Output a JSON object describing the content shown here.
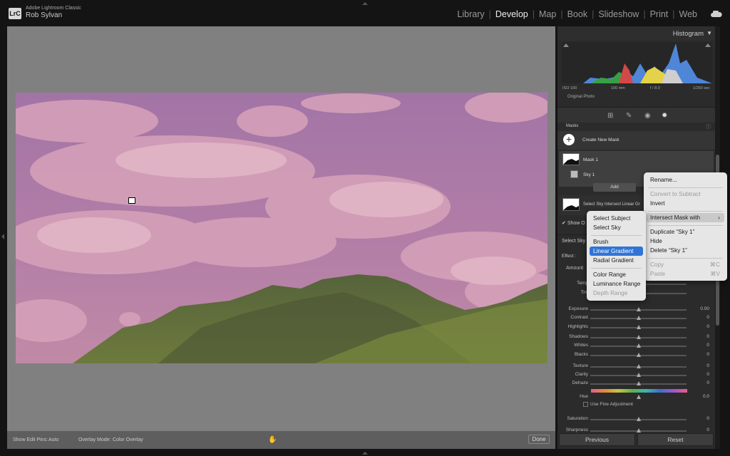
{
  "app": {
    "logo": "LrC",
    "product": "Adobe Lightroom Classic",
    "user": "Rob Sylvan"
  },
  "modules": [
    "Library",
    "Develop",
    "Map",
    "Book",
    "Slideshow",
    "Print",
    "Web"
  ],
  "active_module": "Develop",
  "bottom_bar": {
    "show_edit_pins_label": "Show Edit Pins:",
    "show_edit_pins_value": "Auto",
    "overlay_mode_label": "Overlay Mode:",
    "overlay_mode_value": "Color Overlay",
    "done": "Done"
  },
  "histogram": {
    "title": "Histogram",
    "iso": "ISO 100",
    "focal": "100 mm",
    "aperture": "f / 8.0",
    "shutter": "1/250 sec",
    "original_photo": "Original Photo"
  },
  "masks": {
    "header": "Masks",
    "create_new": "Create New Mask",
    "mask1": "Mask 1",
    "sky1": "Sky 1",
    "add": "Add",
    "select_row": "Select Sky Intersect Linear Gr",
    "show_overlay": "Show O",
    "select_sky": "Select Sky",
    "effect": "Effect :",
    "amount": "Amount"
  },
  "sliders": [
    {
      "label": "Temp",
      "value": "",
      "pos": 0.5
    },
    {
      "label": "Tint",
      "value": "",
      "pos": 0.5
    },
    {
      "label": "Exposure",
      "value": "0.00",
      "pos": 0.5
    },
    {
      "label": "Contrast",
      "value": "0",
      "pos": 0.5
    },
    {
      "label": "Highlights",
      "value": "0",
      "pos": 0.5
    },
    {
      "label": "Shadows",
      "value": "0",
      "pos": 0.5
    },
    {
      "label": "Whites",
      "value": "0",
      "pos": 0.5
    },
    {
      "label": "Blacks",
      "value": "0",
      "pos": 0.5
    },
    {
      "label": "Texture",
      "value": "0",
      "pos": 0.5
    },
    {
      "label": "Clarity",
      "value": "0",
      "pos": 0.5
    },
    {
      "label": "Dehaze",
      "value": "0",
      "pos": 0.5
    },
    {
      "label": "Hue",
      "value": "0.0",
      "pos": 0.5
    },
    {
      "label": "Saturation",
      "value": "0",
      "pos": 0.5
    },
    {
      "label": "Sharpness",
      "value": "0",
      "pos": 0.5
    }
  ],
  "fine_adjustment": "Use Fine Adjustment",
  "panel_buttons": {
    "previous": "Previous",
    "reset": "Reset"
  },
  "context_menu": {
    "rename": "Rename...",
    "convert": "Convert to Subtract",
    "invert": "Invert",
    "intersect": "Intersect Mask with",
    "duplicate": "Duplicate “Sky 1”",
    "hide": "Hide",
    "delete": "Delete “Sky 1”",
    "copy": "Copy",
    "copy_shortcut": "⌘C",
    "paste": "Paste",
    "paste_shortcut": "⌘V"
  },
  "submenu": {
    "select_subject": "Select Subject",
    "select_sky": "Select Sky",
    "brush": "Brush",
    "linear_gradient": "Linear Gradient",
    "radial_gradient": "Radial Gradient",
    "color_range": "Color Range",
    "luminance_range": "Luminance Range",
    "depth_range": "Depth Range"
  },
  "colors": {
    "highlight": "#3074d6",
    "sky_overlay": "#b07aa8"
  }
}
